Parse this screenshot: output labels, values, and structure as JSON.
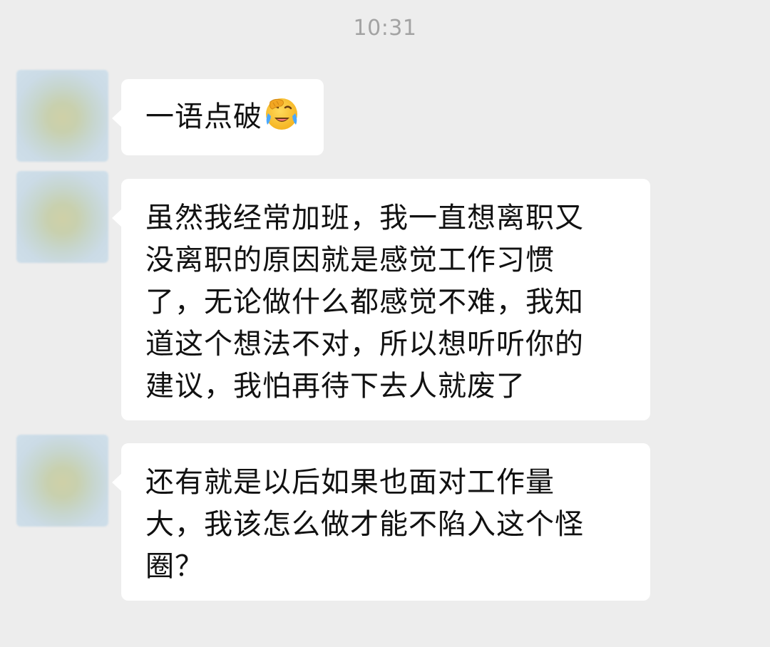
{
  "chat": {
    "timestamp": "10:31",
    "messages": [
      {
        "sender": "contact",
        "text": "一语点破",
        "emoji": "face-with-tears-of-joy-facepalm-icon"
      },
      {
        "sender": "contact",
        "lines": [
          "虽然我经常加班，我一直想离职又",
          "没离职的原因就是感觉工作习惯",
          "了，无论做什么都感觉不难，我知",
          "道这个想法不对，所以想听听你的",
          "建议，我怕再待下去人就废了"
        ]
      },
      {
        "sender": "contact",
        "lines": [
          "还有就是以后如果也面对工作量",
          "大，我该怎么做才能不陷入这个怪",
          "圈？"
        ]
      }
    ]
  },
  "colors": {
    "background": "#ededed",
    "bubble": "#ffffff",
    "timestamp": "#a3a3a3",
    "text": "#111111"
  }
}
